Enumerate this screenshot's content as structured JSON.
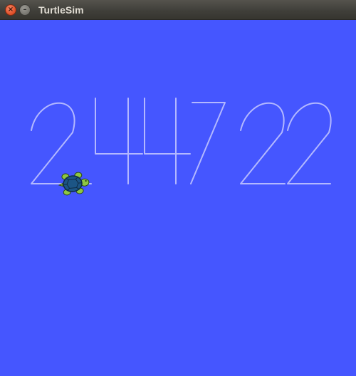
{
  "window": {
    "title": "TurtleSim",
    "close_icon": "close-icon",
    "minimize_icon": "minimize-icon"
  },
  "canvas": {
    "background_color": "#4556ff",
    "pen_color": "#b3b8ff",
    "drawn_text": "244722",
    "turtle_color_shell": "#1c5585",
    "turtle_color_body": "#8ec642",
    "turtle_icon": "turtle-icon"
  }
}
